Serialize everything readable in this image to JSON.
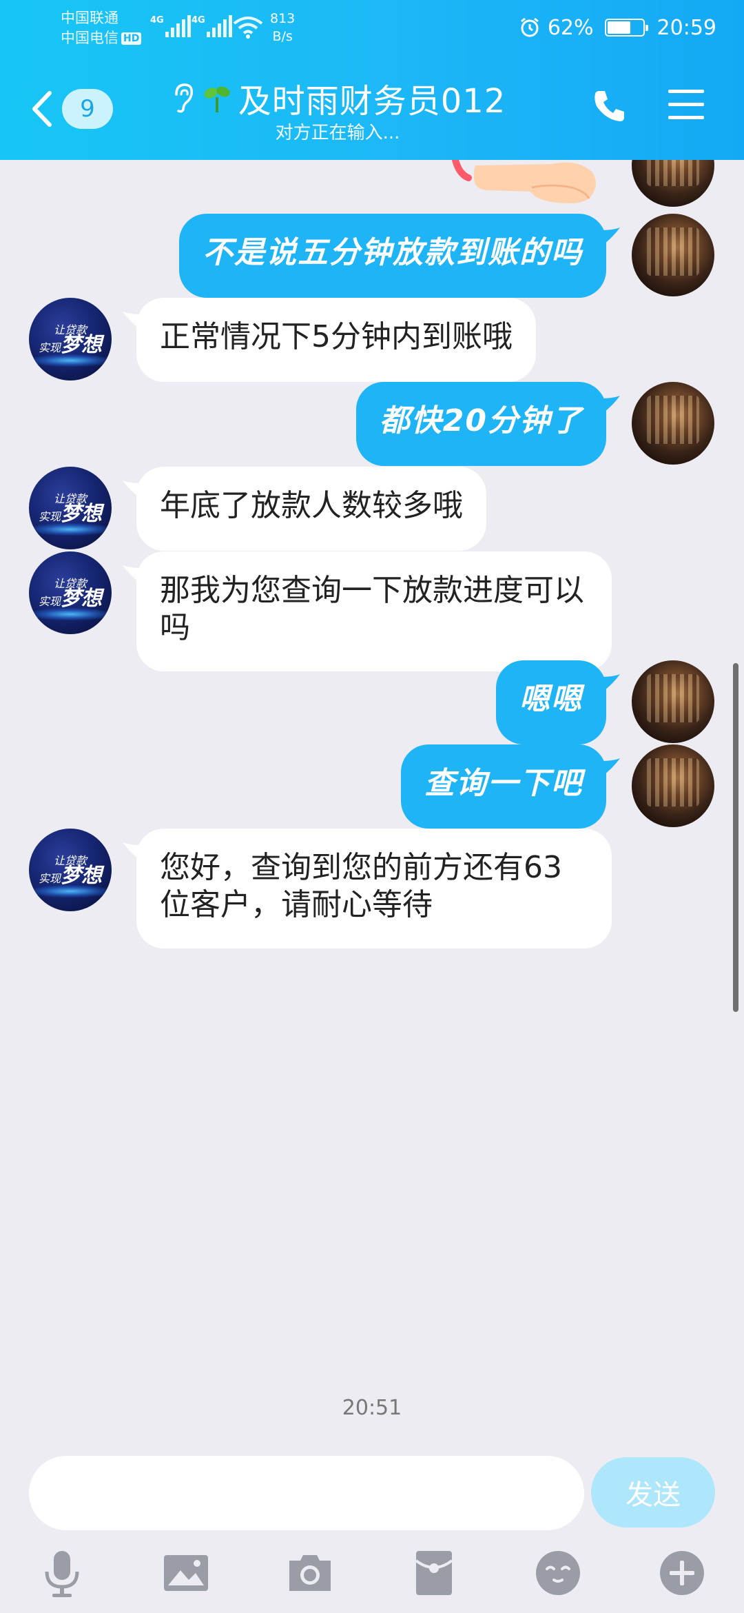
{
  "status_bar": {
    "carrier1": "中国联通",
    "carrier2": "中国电信",
    "hd": "HD",
    "net1": "4G",
    "net2": "4G",
    "speed_value": "813",
    "speed_unit": "B/s",
    "battery": "62%",
    "battery_level": 0.62,
    "time": "20:59"
  },
  "header": {
    "unread_count": "9",
    "title": "及时雨财务员012",
    "subtitle": "对方正在输入..."
  },
  "messages": [
    {
      "side": "out",
      "text": "不是说五分钟放款到账的吗"
    },
    {
      "side": "in",
      "text": "正常情况下5分钟内到账哦"
    },
    {
      "side": "out",
      "text": "都快20分钟了"
    },
    {
      "side": "in",
      "text": "年底了放款人数较多哦"
    },
    {
      "side": "in",
      "text": "那我为您查询一下放款进度可以吗"
    },
    {
      "side": "out",
      "text": "嗯嗯"
    },
    {
      "side": "out",
      "text": "查询一下吧"
    },
    {
      "side": "in",
      "text": "您好，查询到您的前方还有63位客户，请耐心等待"
    }
  ],
  "bot_avatar_text": {
    "line1": "让贷款",
    "line2": "实现",
    "line3": "梦想"
  },
  "timestamp": "20:51",
  "input": {
    "value": "",
    "placeholder": ""
  },
  "send_label": "发送",
  "colors": {
    "header": "#1cb7f7",
    "outgoing_bubble": "#1fb4f5",
    "incoming_bubble": "#ffffff",
    "background": "#ececf2",
    "send_button": "#aee7fb",
    "toolbar_icon": "#9a9da6"
  },
  "icons": [
    "back-chevron-icon",
    "ear-icon",
    "sprout-icon",
    "phone-icon",
    "menu-icon",
    "pointing-hand-sticker",
    "microphone-icon",
    "image-icon",
    "camera-icon",
    "red-packet-icon",
    "emoji-icon",
    "plus-icon"
  ]
}
